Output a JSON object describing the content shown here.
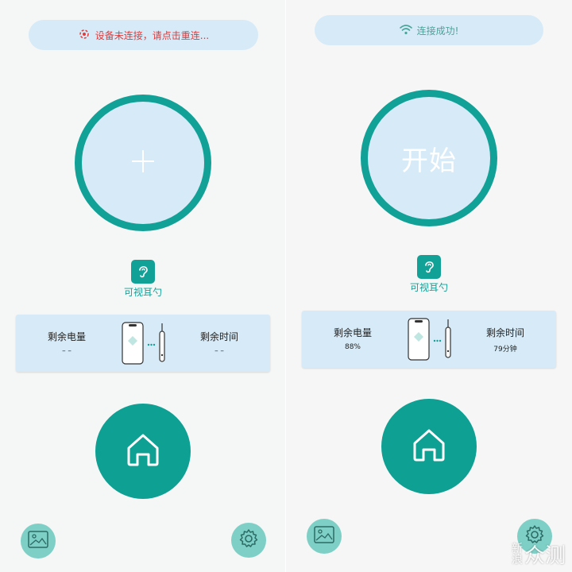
{
  "left": {
    "status": "设备未连接，请点击重连...",
    "center_symbol": "+",
    "app_name": "可视耳勺",
    "battery_label": "剩余电量",
    "battery_value": "– –",
    "time_label": "剩余时间",
    "time_value": "– –"
  },
  "right": {
    "status": "连接成功!",
    "start_label": "开始",
    "app_name": "可视耳勺",
    "battery_label": "剩余电量",
    "battery_value": "88%",
    "time_label": "剩余时间",
    "time_value": "79分钟"
  },
  "watermark": {
    "small_top": "新",
    "small_bottom": "浪",
    "text": "众测"
  },
  "colors": {
    "accent": "#12a197",
    "card": "#d6eaf7",
    "error": "#e23b3b",
    "ok": "#4aa49a",
    "light_button": "#7ecfc6"
  },
  "icons": [
    "device-disconnected-icon",
    "wifi-icon",
    "ear-icon",
    "phone-earpick-icon",
    "home-icon",
    "gallery-icon",
    "settings-gear-icon"
  ]
}
